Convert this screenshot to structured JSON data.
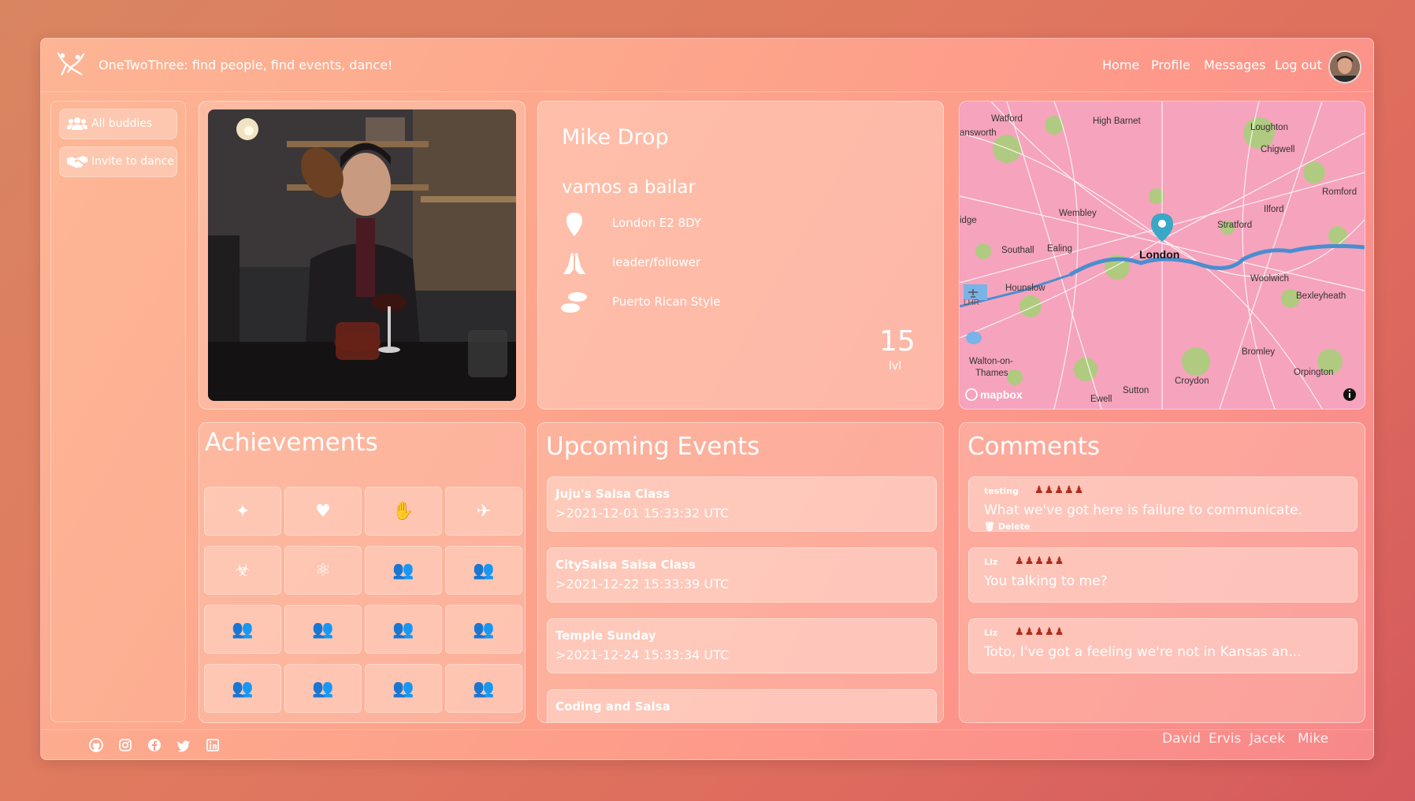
{
  "header": {
    "app_title": "OneTwoThree: find people, find events, dance!",
    "nav": [
      "Home",
      "Profile",
      "Messages",
      "Log out"
    ]
  },
  "sidebar": {
    "items": [
      {
        "label": "All buddies",
        "icon": "users-icon"
      },
      {
        "label": "Invite to dance",
        "icon": "handshake-icon"
      }
    ]
  },
  "profile": {
    "name": "Mike Drop",
    "motto": "vamos a bailar",
    "location": "London E2 8DY",
    "role": "leader/follower",
    "style": "Puerto Rican Style",
    "level": "15",
    "level_label": "lvl"
  },
  "map": {
    "places": [
      "Watford",
      "High Barnet",
      "Loughton",
      "Chigwell",
      "answorth",
      "Romford",
      "Wembley",
      "Ilford",
      "idge",
      "Stratford",
      "Southall",
      "Ealing",
      "London",
      "LHR",
      "Hounslow",
      "Woolwich",
      "Bexleyheath",
      "Walton-on-",
      "Thames",
      "Bromley",
      "Croydon",
      "Orpington",
      "Sutton",
      "Ewell"
    ],
    "attribution": "mapbox",
    "info_icon": "info-icon",
    "marker_color": "#3aa7c7"
  },
  "achievements": {
    "title": "Achievements",
    "icons": [
      "bug-icon",
      "heartbeat-icon",
      "hand-icon",
      "plane-icon",
      "biohazard-icon",
      "atom-icon",
      "users-icon",
      "users-icon",
      "users-icon",
      "users-icon",
      "users-icon",
      "users-icon",
      "users-icon",
      "users-icon",
      "users-icon",
      "users-icon"
    ]
  },
  "events": {
    "title": "Upcoming Events",
    "items": [
      {
        "title": "Juju's Salsa Class",
        "date": ">2021-12-01 15:33:32 UTC"
      },
      {
        "title": "CitySalsa Salsa Class",
        "date": ">2021-12-22 15:33:39 UTC"
      },
      {
        "title": "Temple Sunday",
        "date": ">2021-12-24 15:33:34 UTC"
      },
      {
        "title": "Coding and Salsa",
        "date": ""
      }
    ]
  },
  "comments": {
    "title": "Comments",
    "items": [
      {
        "user": "testing",
        "stars": 5,
        "text": "What we've got here is failure to communicate.",
        "delete": "Delete"
      },
      {
        "user": "Liz",
        "stars": 5,
        "text": "You talking to me?"
      },
      {
        "user": "Liz",
        "stars": 5,
        "text": "Toto, I've got a feeling we're not in Kansas an..."
      }
    ]
  },
  "footer": {
    "social": [
      "github-icon",
      "instagram-icon",
      "facebook-icon",
      "twitter-icon",
      "linkedin-icon"
    ],
    "developers": [
      "David",
      "Ervis",
      "Jacek",
      "Mike"
    ]
  }
}
